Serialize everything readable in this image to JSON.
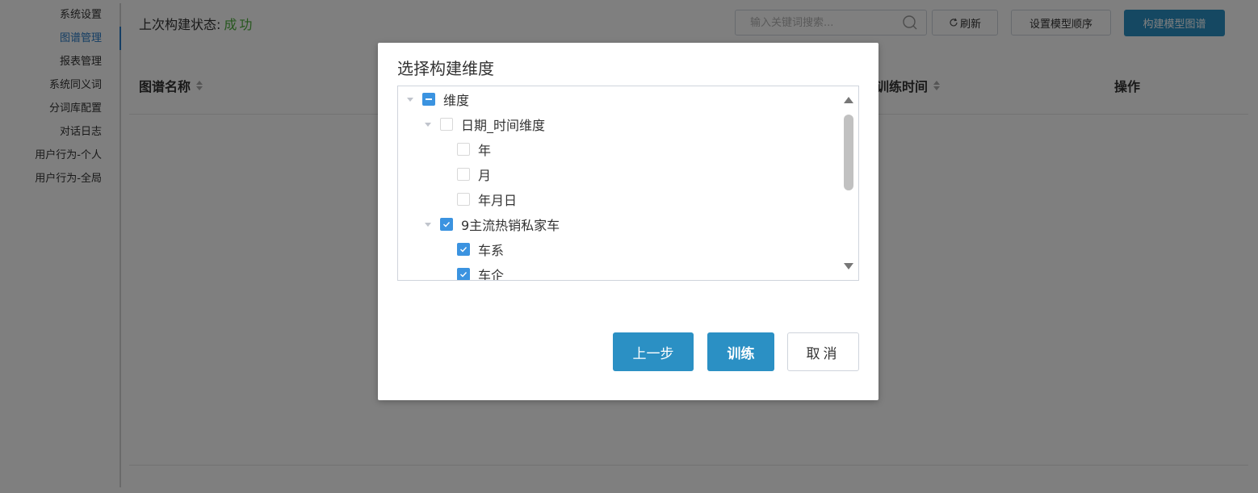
{
  "sidebar": {
    "items": [
      {
        "label": "系统设置"
      },
      {
        "label": "图谱管理",
        "active": true
      },
      {
        "label": "报表管理"
      },
      {
        "label": "系统同义词"
      },
      {
        "label": "分词库配置"
      },
      {
        "label": "对话日志"
      },
      {
        "label": "用户行为-个人"
      },
      {
        "label": "用户行为-全局"
      }
    ]
  },
  "header": {
    "status_label": "上次构建状态:",
    "status_value": "成功",
    "search_placeholder": "输入关键词搜索...",
    "refresh_label": "刷新",
    "order_label": "设置模型顺序",
    "build_label": "构建模型图谱"
  },
  "table": {
    "columns": [
      "图谱名称",
      "训练时间",
      "操作"
    ]
  },
  "modal": {
    "title": "选择构建维度",
    "tree": [
      {
        "label": "维度",
        "state": "partial",
        "expanded": true
      },
      {
        "label": "日期_时间维度",
        "state": "unchecked",
        "expanded": true
      },
      {
        "label": "年",
        "state": "unchecked"
      },
      {
        "label": "月",
        "state": "unchecked"
      },
      {
        "label": "年月日",
        "state": "unchecked"
      },
      {
        "label": "9主流热销私家车",
        "state": "checked",
        "expanded": true
      },
      {
        "label": "车系",
        "state": "checked"
      },
      {
        "label": "车企",
        "state": "checked"
      }
    ],
    "prev_label": "上一步",
    "train_label": "训练",
    "cancel_label": "取消"
  },
  "colors": {
    "primary": "#2b90c4",
    "checkbox": "#3b93e0",
    "success": "#4cae3b",
    "active_nav": "#2a7dc9"
  }
}
